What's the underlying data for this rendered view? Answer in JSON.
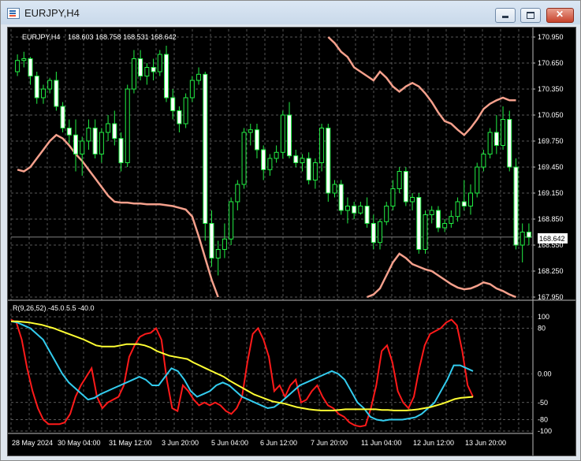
{
  "window": {
    "title": "EURJPY,H4"
  },
  "chart_data": [
    {
      "type": "candlestick",
      "symbol_label": "EURJPY,H4",
      "ohlc_label": "168.603 168.758 168.531 168.642",
      "current_price": "168.642",
      "ylim": [
        167.95,
        170.95
      ],
      "y_ticks": [
        "170.950",
        "170.650",
        "170.350",
        "170.050",
        "169.750",
        "169.450",
        "169.150",
        "168.850",
        "168.550",
        "168.250",
        "167.950"
      ],
      "x_ticks": [
        "28 May 2024",
        "30 May 04:00",
        "31 May 12:00",
        "3 Jun 20:00",
        "5 Jun 04:00",
        "6 Jun 12:00",
        "7 Jun 20:00",
        "11 Jun 04:00",
        "12 Jun 12:00",
        "13 Jun 20:00"
      ],
      "candles": [
        [
          170.55,
          170.75,
          170.5,
          170.68
        ],
        [
          170.68,
          170.78,
          170.6,
          170.7
        ],
        [
          170.7,
          170.72,
          170.4,
          170.5
        ],
        [
          170.5,
          170.55,
          170.18,
          170.25
        ],
        [
          170.25,
          170.4,
          170.18,
          170.35
        ],
        [
          170.35,
          170.48,
          170.3,
          170.45
        ],
        [
          170.45,
          170.55,
          170.1,
          170.15
        ],
        [
          170.15,
          170.2,
          169.85,
          169.9
        ],
        [
          169.9,
          170.0,
          169.72,
          169.82
        ],
        [
          169.82,
          170.0,
          169.4,
          169.6
        ],
        [
          169.6,
          169.8,
          169.35,
          169.75
        ],
        [
          169.75,
          170.0,
          169.65,
          169.9
        ],
        [
          169.9,
          170.0,
          169.55,
          169.6
        ],
        [
          169.6,
          169.9,
          169.5,
          169.85
        ],
        [
          169.85,
          170.05,
          169.75,
          169.95
        ],
        [
          169.95,
          170.1,
          169.7,
          169.78
        ],
        [
          169.78,
          169.85,
          169.4,
          169.5
        ],
        [
          169.5,
          170.4,
          169.45,
          170.35
        ],
        [
          170.35,
          170.8,
          170.3,
          170.7
        ],
        [
          170.7,
          170.8,
          170.45,
          170.5
        ],
        [
          170.5,
          170.65,
          170.4,
          170.6
        ],
        [
          170.6,
          170.7,
          170.45,
          170.55
        ],
        [
          170.55,
          170.8,
          170.5,
          170.75
        ],
        [
          170.75,
          170.85,
          170.2,
          170.25
        ],
        [
          170.25,
          170.35,
          170.0,
          170.1
        ],
        [
          170.1,
          170.15,
          169.85,
          169.95
        ],
        [
          169.95,
          170.3,
          169.9,
          170.25
        ],
        [
          170.25,
          170.5,
          170.2,
          170.45
        ],
        [
          170.45,
          170.6,
          170.4,
          170.52
        ],
        [
          170.52,
          170.55,
          168.6,
          168.8
        ],
        [
          168.8,
          168.95,
          168.3,
          168.4
        ],
        [
          168.4,
          168.6,
          168.2,
          168.5
        ],
        [
          168.5,
          168.8,
          168.4,
          168.62
        ],
        [
          168.62,
          169.1,
          168.55,
          169.05
        ],
        [
          169.05,
          169.3,
          168.95,
          169.25
        ],
        [
          169.25,
          169.9,
          169.2,
          169.85
        ],
        [
          169.85,
          169.95,
          169.7,
          169.88
        ],
        [
          169.88,
          169.95,
          169.55,
          169.65
        ],
        [
          169.65,
          169.7,
          169.3,
          169.42
        ],
        [
          169.42,
          169.6,
          169.35,
          169.55
        ],
        [
          169.55,
          169.7,
          169.5,
          169.62
        ],
        [
          169.62,
          170.1,
          169.55,
          170.05
        ],
        [
          170.05,
          170.2,
          169.55,
          169.58
        ],
        [
          169.58,
          169.65,
          169.45,
          169.5
        ],
        [
          169.5,
          169.6,
          169.4,
          169.55
        ],
        [
          169.55,
          169.62,
          169.25,
          169.3
        ],
        [
          169.3,
          169.55,
          169.2,
          169.5
        ],
        [
          169.5,
          169.95,
          169.4,
          169.9
        ],
        [
          169.9,
          169.95,
          169.05,
          169.15
        ],
        [
          169.15,
          169.3,
          169.1,
          169.25
        ],
        [
          169.25,
          169.3,
          168.9,
          168.95
        ],
        [
          168.95,
          169.1,
          168.8,
          169.0
        ],
        [
          169.0,
          169.05,
          168.85,
          168.92
        ],
        [
          168.92,
          169.05,
          168.9,
          169.0
        ],
        [
          169.0,
          169.1,
          168.75,
          168.8
        ],
        [
          168.8,
          168.9,
          168.5,
          168.58
        ],
        [
          168.58,
          168.85,
          168.5,
          168.82
        ],
        [
          168.82,
          169.05,
          168.78,
          169.0
        ],
        [
          169.0,
          169.3,
          168.95,
          169.2
        ],
        [
          169.2,
          169.45,
          169.15,
          169.4
        ],
        [
          169.4,
          169.45,
          169.0,
          169.05
        ],
        [
          169.05,
          169.15,
          168.95,
          169.1
        ],
        [
          169.1,
          169.15,
          168.45,
          168.5
        ],
        [
          168.5,
          168.95,
          168.45,
          168.9
        ],
        [
          168.9,
          169.0,
          168.8,
          168.95
        ],
        [
          168.95,
          169.0,
          168.7,
          168.75
        ],
        [
          168.75,
          168.85,
          168.7,
          168.8
        ],
        [
          168.8,
          168.95,
          168.75,
          168.88
        ],
        [
          168.88,
          169.1,
          168.82,
          169.05
        ],
        [
          169.05,
          169.3,
          168.95,
          169.0
        ],
        [
          169.0,
          169.25,
          168.9,
          169.15
        ],
        [
          169.15,
          169.5,
          169.1,
          169.45
        ],
        [
          169.45,
          169.65,
          169.4,
          169.6
        ],
        [
          169.6,
          169.9,
          169.55,
          169.85
        ],
        [
          169.85,
          170.05,
          169.6,
          169.7
        ],
        [
          169.7,
          170.15,
          169.65,
          170.0
        ],
        [
          170.0,
          170.1,
          169.4,
          169.45
        ],
        [
          169.45,
          169.55,
          168.5,
          168.55
        ],
        [
          168.55,
          168.8,
          168.35,
          168.7
        ],
        [
          168.7,
          168.8,
          168.55,
          168.64
        ]
      ],
      "bands": {
        "color": "#f5a08c",
        "upper": [
          null,
          null,
          null,
          null,
          null,
          null,
          null,
          null,
          null,
          null,
          null,
          null,
          null,
          null,
          null,
          null,
          null,
          null,
          null,
          null,
          null,
          null,
          null,
          null,
          null,
          null,
          null,
          null,
          null,
          null,
          null,
          null,
          null,
          null,
          null,
          null,
          null,
          null,
          null,
          null,
          null,
          null,
          null,
          null,
          null,
          null,
          null,
          null,
          170.95,
          170.88,
          170.78,
          170.72,
          170.6,
          170.55,
          170.5,
          170.45,
          170.55,
          170.48,
          170.38,
          170.32,
          170.38,
          170.42,
          170.38,
          170.3,
          170.2,
          170.08,
          169.98,
          169.95,
          169.88,
          169.82,
          169.9,
          170.0,
          170.12,
          170.18,
          170.22,
          170.25,
          170.22,
          170.22,
          null,
          null
        ],
        "lower": [
          169.42,
          169.4,
          169.45,
          169.55,
          169.65,
          169.75,
          169.82,
          169.78,
          169.7,
          169.6,
          169.52,
          169.42,
          169.32,
          169.22,
          169.12,
          169.05,
          169.04,
          169.04,
          169.03,
          169.03,
          169.02,
          169.02,
          169.02,
          169.01,
          169.0,
          168.98,
          168.96,
          168.88,
          168.65,
          168.4,
          168.15,
          167.9,
          null,
          null,
          null,
          null,
          null,
          null,
          null,
          null,
          null,
          null,
          null,
          null,
          null,
          null,
          null,
          null,
          null,
          null,
          null,
          null,
          null,
          null,
          167.95,
          167.98,
          168.05,
          168.2,
          168.35,
          168.45,
          168.4,
          168.33,
          168.3,
          168.27,
          168.25,
          168.2,
          168.15,
          168.1,
          168.06,
          168.04,
          168.05,
          168.08,
          168.12,
          168.1,
          168.05,
          168.02,
          167.98,
          167.95,
          null,
          null
        ]
      }
    },
    {
      "type": "line",
      "indicator_label": "R(9,26,52) -45.0 5.5 -40.0",
      "ylim": [
        -100,
        100
      ],
      "y_ticks": [
        100,
        80,
        0,
        -50,
        -80,
        -100
      ],
      "y_tick_labels": [
        "100",
        "80",
        "0.00",
        "-50",
        "-80",
        "-100"
      ],
      "series": [
        {
          "color": "#ff1a1a",
          "values": [
            95,
            90,
            60,
            10,
            -30,
            -60,
            -80,
            -88,
            -88,
            -88,
            -85,
            -70,
            -40,
            -20,
            -5,
            10,
            -40,
            -60,
            -50,
            -45,
            -40,
            -20,
            30,
            50,
            65,
            70,
            72,
            80,
            60,
            -10,
            -60,
            -65,
            -20,
            -30,
            -45,
            -55,
            -50,
            -55,
            -50,
            -55,
            -65,
            -70,
            -60,
            -40,
            20,
            70,
            80,
            60,
            30,
            -30,
            -20,
            -40,
            -20,
            -10,
            -50,
            -45,
            -30,
            -20,
            -40,
            -55,
            -60,
            -70,
            -75,
            -85,
            -90,
            -92,
            -90,
            -60,
            -20,
            40,
            50,
            20,
            -30,
            -50,
            -60,
            -40,
            10,
            50,
            70,
            75,
            80,
            90,
            95,
            85,
            40,
            -20,
            -40
          ]
        },
        {
          "color": "#33ccee",
          "values": [
            92,
            90,
            85,
            80,
            70,
            60,
            40,
            20,
            0,
            -15,
            -25,
            -35,
            -45,
            -42,
            -35,
            -30,
            -25,
            -20,
            -15,
            -10,
            -5,
            -10,
            -20,
            -20,
            -5,
            10,
            5,
            -10,
            -30,
            -40,
            -35,
            -30,
            -20,
            -15,
            -20,
            -30,
            -40,
            -45,
            -50,
            -55,
            -60,
            -58,
            -50,
            -40,
            -30,
            -20,
            -15,
            -10,
            -5,
            0,
            5,
            0,
            -10,
            -30,
            -50,
            -60,
            -75,
            -80,
            -82,
            -80,
            -80,
            -80,
            -78,
            -76,
            -70,
            -60,
            -50,
            -30,
            -10,
            15,
            15,
            10,
            5
          ]
        },
        {
          "color": "#ffff33",
          "values": [
            92,
            92,
            91,
            90,
            88,
            86,
            83,
            80,
            76,
            72,
            68,
            64,
            60,
            55,
            50,
            48,
            48,
            48,
            50,
            52,
            52,
            52,
            50,
            46,
            40,
            36,
            32,
            30,
            28,
            26,
            20,
            15,
            10,
            5,
            0,
            -5,
            -12,
            -18,
            -24,
            -30,
            -36,
            -40,
            -44,
            -48,
            -50,
            -52,
            -55,
            -58,
            -60,
            -62,
            -63,
            -64,
            -64,
            -64,
            -63,
            -62,
            -62,
            -62,
            -62,
            -62,
            -62,
            -63,
            -63,
            -64,
            -64,
            -64,
            -63,
            -62,
            -60,
            -58,
            -55,
            -52,
            -48,
            -44,
            -42,
            -41,
            -40
          ]
        }
      ]
    }
  ]
}
